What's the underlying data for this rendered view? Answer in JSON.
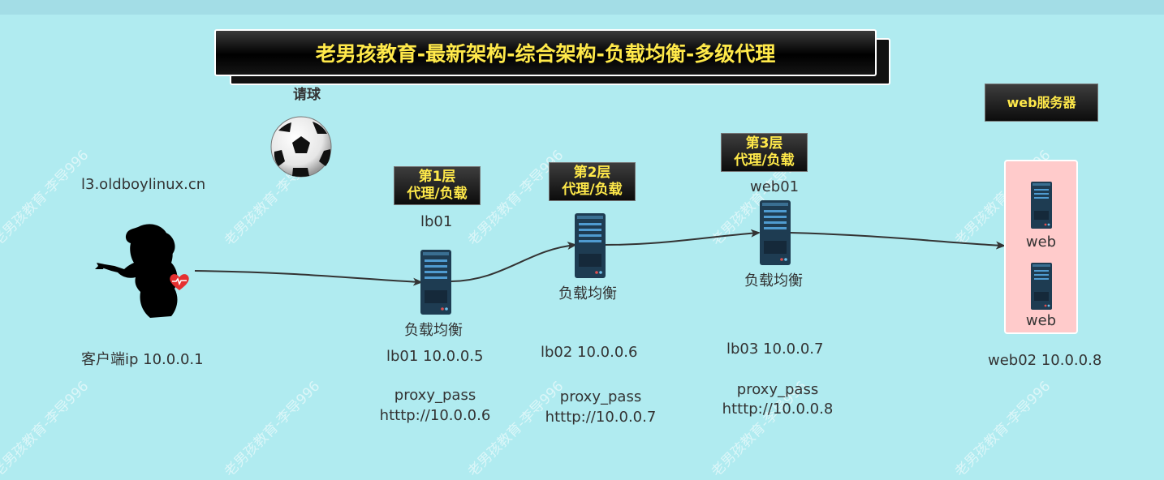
{
  "title": "老男孩教育-最新架构-综合架构-负载均衡-多级代理",
  "ball_label": "请球",
  "client": {
    "domain": "l3.oldboylinux.cn",
    "ip": "客户端ip 10.0.0.1"
  },
  "tiers": [
    {
      "badge_line1": "第1层",
      "badge_line2": "代理/负载",
      "name": "lb01",
      "role": "负载均衡",
      "ip": "lb01 10.0.0.5",
      "proxy_label": "proxy_pass",
      "proxy_target": "htttp://10.0.0.6"
    },
    {
      "badge_line1": "第2层",
      "badge_line2": "代理/负载",
      "role": "负载均衡",
      "ip": "lb02 10.0.0.6",
      "proxy_label": "proxy_pass",
      "proxy_target": "htttp://10.0.0.7"
    },
    {
      "badge_line1": "第3层",
      "badge_line2": "代理/负载",
      "name": "web01",
      "role": "负载均衡",
      "ip": "lb03 10.0.0.7",
      "proxy_label": "proxy_pass",
      "proxy_target": "htttp://10.0.0.8"
    }
  ],
  "web_servers": {
    "badge": "web服务器",
    "items": [
      "web",
      "web"
    ],
    "ip": "web02 10.0.0.8"
  },
  "watermark": "老男孩教育-李导996",
  "colors": {
    "background": "#b0ebf0",
    "badge_text": "#ffe94a",
    "web_box": "#ffcbcb"
  }
}
